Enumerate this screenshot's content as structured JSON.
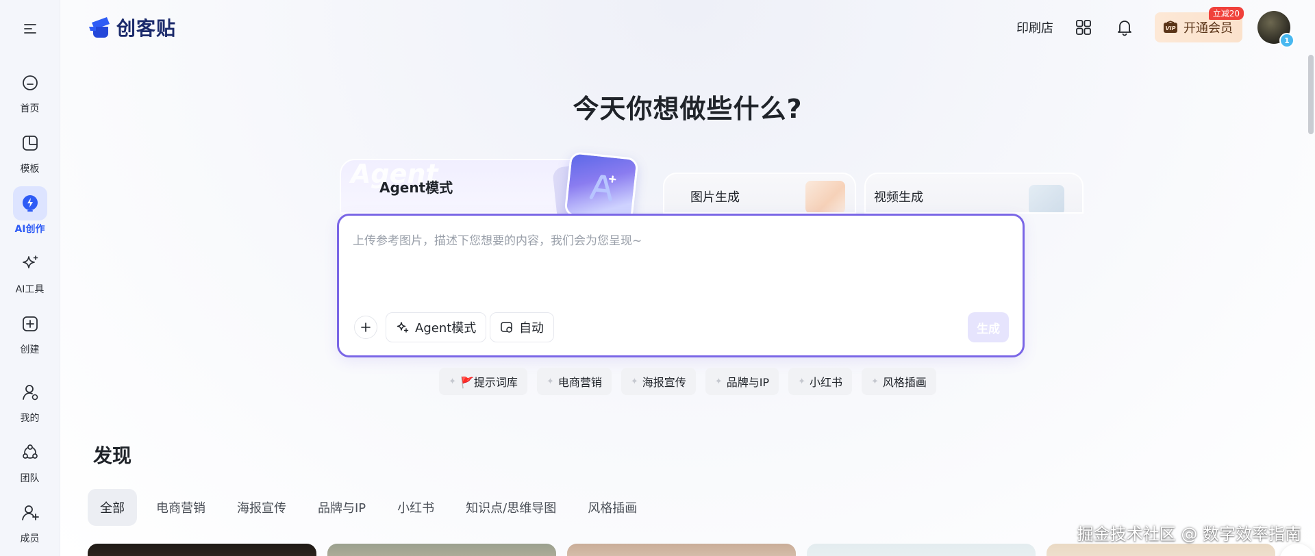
{
  "app": {
    "logo_text": "创客贴"
  },
  "sidebar": {
    "items": [
      {
        "label": "首页",
        "icon": "home-icon"
      },
      {
        "label": "模板",
        "icon": "template-icon"
      },
      {
        "label": "AI创作",
        "icon": "ai-create-icon",
        "active": true
      },
      {
        "label": "AI工具",
        "icon": "sparkle-icon"
      },
      {
        "label": "创建",
        "icon": "plus-square-icon"
      },
      {
        "label": "我的",
        "icon": "user-icon"
      },
      {
        "label": "团队",
        "icon": "team-icon"
      },
      {
        "label": "成员",
        "icon": "add-member-icon"
      }
    ]
  },
  "header": {
    "print_shop": "印刷店",
    "vip_label": "开通会员",
    "vip_badge": "立减20",
    "avatar_badge": "1"
  },
  "hero": {
    "headline": "今天你想做些什么?"
  },
  "mode_tabs": {
    "agent": {
      "label": "Agent模式",
      "ghost": "Agent"
    },
    "image": {
      "label": "图片生成"
    },
    "video": {
      "label": "视频生成"
    }
  },
  "prompt": {
    "placeholder": "上传参考图片，描述下您想要的内容，我们会为您呈现~",
    "value": "",
    "mode_chip": "Agent模式",
    "auto_chip": "自动",
    "generate": "生成"
  },
  "suggestions": [
    "🚩提示词库",
    "电商营销",
    "海报宣传",
    "品牌与IP",
    "小红书",
    "风格插画"
  ],
  "discover": {
    "title": "发现",
    "categories": [
      "全部",
      "电商营销",
      "海报宣传",
      "品牌与IP",
      "小红书",
      "知识点/思维导图",
      "风格插画"
    ]
  },
  "watermark": "掘金技术社区 @ 数字效率指南",
  "colors": {
    "accent": "#2f5cf5",
    "prompt_border": "#7a66e6",
    "vip_bg": "#fde8d6",
    "badge_red": "#f0413b"
  }
}
